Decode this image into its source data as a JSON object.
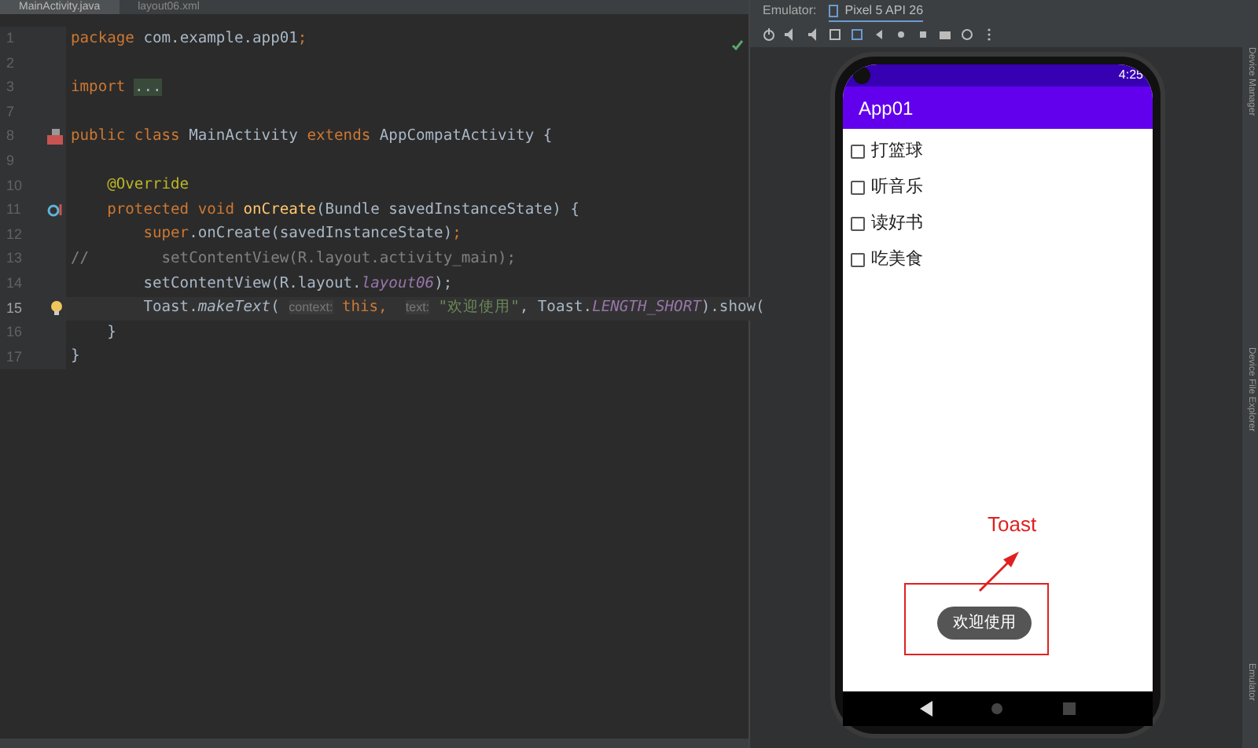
{
  "editor": {
    "tabs": [
      {
        "label": "MainActivity.java",
        "selected": true
      },
      {
        "label": "layout06.xml",
        "selected": false
      }
    ],
    "lines": [
      {
        "number": "1",
        "current": false,
        "kind": "plain",
        "tokens": [
          {
            "kind": "keyword",
            "text": "package"
          },
          {
            "kind": "plain",
            "text": " com.example.app01"
          },
          {
            "kind": "keyword",
            "text": ";"
          }
        ]
      },
      {
        "number": "2",
        "current": false,
        "kind": "plain"
      },
      {
        "number": "3",
        "current": false,
        "kind": "plain",
        "tokens": [
          {
            "kind": "keyword",
            "text": "import "
          },
          {
            "kind": "folded",
            "text": "..."
          }
        ]
      },
      {
        "number": "7",
        "current": false,
        "kind": "plain"
      },
      {
        "number": "8",
        "current": false,
        "kind": "class",
        "tokens": [
          {
            "kind": "keyword",
            "text": "public class "
          },
          {
            "kind": "plain",
            "text": "MainActivity "
          },
          {
            "kind": "keyword",
            "text": "extends "
          },
          {
            "kind": "plain",
            "text": "AppCompatActivity {"
          }
        ]
      },
      {
        "number": "9",
        "current": false,
        "kind": "plain"
      },
      {
        "number": "10",
        "current": false,
        "kind": "plain",
        "tokens": [
          {
            "kind": "annotation",
            "text": "    @Override"
          }
        ]
      },
      {
        "number": "11",
        "current": false,
        "kind": "override",
        "tokens": [
          {
            "kind": "keyword",
            "text": "    protected void "
          },
          {
            "kind": "method",
            "text": "onCreate"
          },
          {
            "kind": "plain",
            "text": "(Bundle savedInstanceState) {"
          }
        ]
      },
      {
        "number": "12",
        "current": false,
        "kind": "plain",
        "tokens": [
          {
            "kind": "keyword",
            "text": "        super"
          },
          {
            "kind": "plain",
            "text": ".onCreate(savedInstanceState)"
          },
          {
            "kind": "keyword",
            "text": ";"
          }
        ]
      },
      {
        "number": "13",
        "current": false,
        "kind": "plain",
        "tokens": [
          {
            "kind": "comment",
            "text": "//        setContentView(R.layout.activity_main);"
          }
        ]
      },
      {
        "number": "14",
        "current": false,
        "kind": "plain",
        "tokens": [
          {
            "kind": "plain",
            "text": "        setContentView(R.layout."
          },
          {
            "kind": "field",
            "text": "layout06"
          },
          {
            "kind": "plain",
            "text": ");"
          }
        ]
      },
      {
        "number": "15",
        "current": true,
        "kind": "bulb",
        "tokens": [
          {
            "kind": "plain",
            "text": "        Toast."
          },
          {
            "kind": "static",
            "text": "makeText"
          },
          {
            "kind": "plain",
            "text": "( "
          },
          {
            "kind": "hint",
            "text": "context:"
          },
          {
            "kind": "keyword",
            "text": " this,  "
          },
          {
            "kind": "hint",
            "text": "text:"
          },
          {
            "kind": "string",
            "text": " \"欢迎使用\""
          },
          {
            "kind": "plain",
            "text": ", Toast."
          },
          {
            "kind": "field",
            "text": "LENGTH_SHORT"
          },
          {
            "kind": "plain",
            "text": ").show("
          }
        ]
      },
      {
        "number": "16",
        "current": false,
        "kind": "plain",
        "tokens": [
          {
            "kind": "plain",
            "text": "    }"
          }
        ]
      },
      {
        "number": "17",
        "current": false,
        "kind": "plain",
        "tokens": [
          {
            "kind": "plain",
            "text": "}"
          }
        ]
      }
    ]
  },
  "emulator": {
    "label": "Emulator:",
    "device_tab": "Pixel 5 API 26",
    "phone": {
      "time": "4:25",
      "app_title": "App01",
      "checkboxes": [
        {
          "label": "打篮球",
          "checked": false
        },
        {
          "label": "听音乐",
          "checked": false
        },
        {
          "label": "读好书",
          "checked": false
        },
        {
          "label": "吃美食",
          "checked": false
        }
      ],
      "toast": "欢迎使用",
      "annotation": "Toast"
    }
  },
  "side_tools": [
    "Device Manager",
    "Device File Explorer",
    "Emulator"
  ]
}
